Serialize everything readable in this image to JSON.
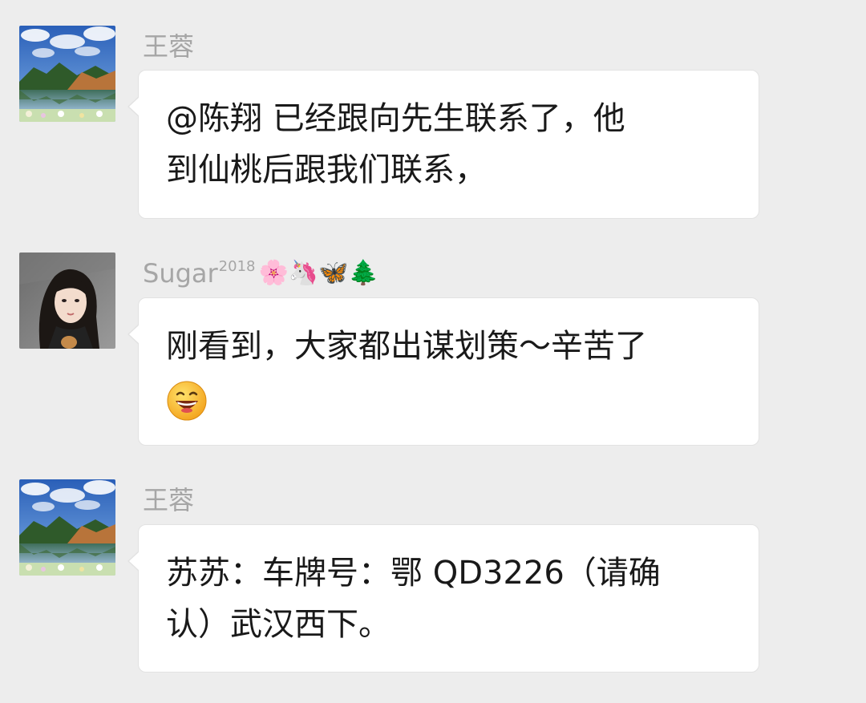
{
  "messages": [
    {
      "sender": "王蓉",
      "avatar_icon": "landscape-lake-avatar",
      "lines": [
        "@陈翔  已经跟向先生联系了，他",
        "到仙桃后跟我们联系，"
      ]
    },
    {
      "sender": "Sugar",
      "sender_sup": "2018",
      "sender_emoji": "🌸🦄🦋🌲",
      "avatar_icon": "portrait-photo-avatar",
      "lines": [
        "刚看到，大家都出谋划策～辛苦了"
      ],
      "trailing_emoji": "grinning-face-emoji"
    },
    {
      "sender": "王蓉",
      "avatar_icon": "landscape-lake-avatar",
      "lines": [
        "苏苏：车牌号：鄂 QD3226（请确",
        "认）武汉西下。"
      ]
    }
  ],
  "colors": {
    "background": "#ededed",
    "bubble": "#ffffff",
    "sender_name": "#a6a6a6",
    "message_text": "#191919"
  }
}
